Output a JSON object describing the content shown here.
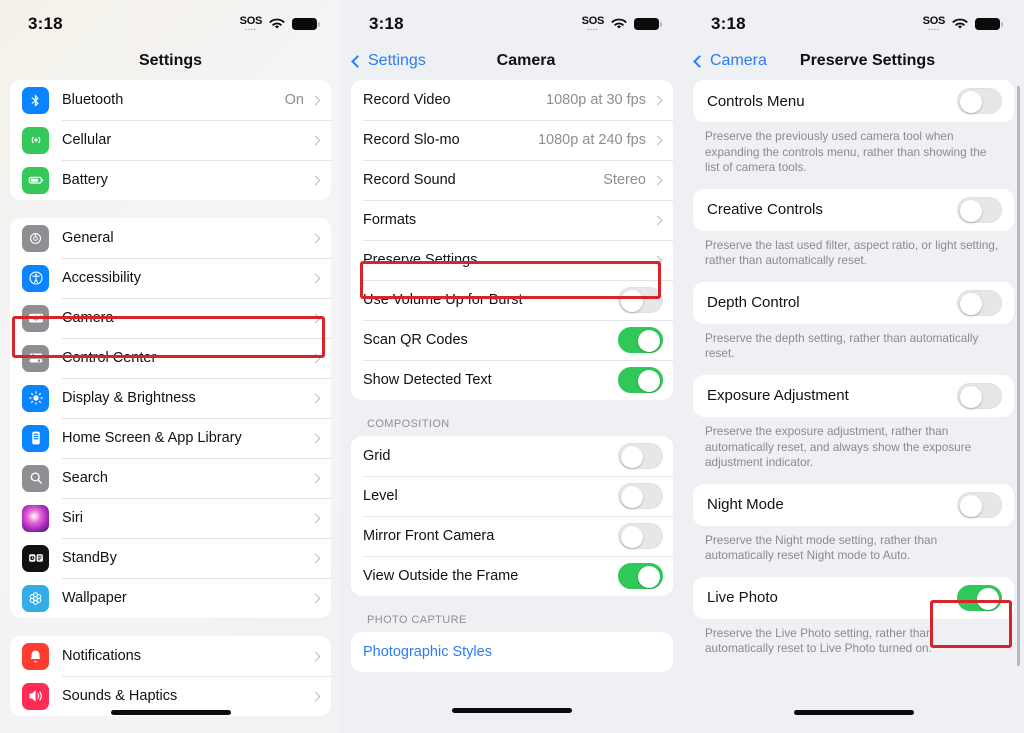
{
  "status": {
    "time": "3:18",
    "sos_label": "SOS",
    "wifi_icon": "wifi-icon",
    "battery_icon": "battery-icon"
  },
  "colors": {
    "accent_blue": "#2b7cf6",
    "toggle_on_green": "#31c85a",
    "annotation_red": "#d8232a",
    "page_bg": "#eff0f4",
    "card_bg": "#ffffff",
    "secondary_text": "#8e8e93"
  },
  "panels": {
    "left": {
      "nav_title": "Settings",
      "groups": [
        {
          "rows": [
            {
              "label": "Bluetooth",
              "value": "On",
              "icon": "bluetooth-icon",
              "icon_color": "#0a84ff",
              "type": "link"
            },
            {
              "label": "Cellular",
              "value": "",
              "icon": "cellular-icon",
              "icon_color": "#34c759",
              "type": "link"
            },
            {
              "label": "Battery",
              "value": "",
              "icon": "battery-app-icon",
              "icon_color": "#34c759",
              "type": "link"
            }
          ]
        },
        {
          "rows": [
            {
              "label": "General",
              "value": "",
              "icon": "gear-icon",
              "icon_color": "#8e8e93",
              "type": "link"
            },
            {
              "label": "Accessibility",
              "value": "",
              "icon": "accessibility-icon",
              "icon_color": "#0a84ff",
              "type": "link"
            },
            {
              "label": "Camera",
              "value": "",
              "icon": "camera-icon",
              "icon_color": "#8e8e93",
              "type": "link",
              "highlighted": true
            },
            {
              "label": "Control Center",
              "value": "",
              "icon": "control-center-icon",
              "icon_color": "#8e8e93",
              "type": "link"
            },
            {
              "label": "Display & Brightness",
              "value": "",
              "icon": "brightness-icon",
              "icon_color": "#0a84ff",
              "type": "link"
            },
            {
              "label": "Home Screen & App Library",
              "value": "",
              "icon": "home-screen-icon",
              "icon_color": "#0a84ff",
              "type": "link"
            },
            {
              "label": "Search",
              "value": "",
              "icon": "search-icon",
              "icon_color": "#8e8e93",
              "type": "link"
            },
            {
              "label": "Siri",
              "value": "",
              "icon": "siri-icon",
              "icon_color": "#5b2bd6",
              "type": "link"
            },
            {
              "label": "StandBy",
              "value": "",
              "icon": "standby-icon",
              "icon_color": "#111111",
              "type": "link"
            },
            {
              "label": "Wallpaper",
              "value": "",
              "icon": "wallpaper-icon",
              "icon_color": "#32ade6",
              "type": "link"
            }
          ]
        },
        {
          "rows": [
            {
              "label": "Notifications",
              "value": "",
              "icon": "notifications-icon",
              "icon_color": "#ff3b30",
              "type": "link"
            },
            {
              "label": "Sounds & Haptics",
              "value": "",
              "icon": "sounds-icon",
              "icon_color": "#ff2d55",
              "type": "link"
            }
          ]
        }
      ]
    },
    "middle": {
      "nav_back": "Settings",
      "nav_title": "Camera",
      "groups": [
        {
          "rows": [
            {
              "label": "Record Video",
              "value": "1080p at 30 fps",
              "type": "link"
            },
            {
              "label": "Record Slo-mo",
              "value": "1080p at 240 fps",
              "type": "link"
            },
            {
              "label": "Record Sound",
              "value": "Stereo",
              "type": "link"
            },
            {
              "label": "Formats",
              "value": "",
              "type": "link"
            },
            {
              "label": "Preserve Settings",
              "value": "",
              "type": "link",
              "highlighted": true
            },
            {
              "label": "Use Volume Up for Burst",
              "value": "",
              "type": "toggle",
              "on": false
            },
            {
              "label": "Scan QR Codes",
              "value": "",
              "type": "toggle",
              "on": true
            },
            {
              "label": "Show Detected Text",
              "value": "",
              "type": "toggle",
              "on": true
            }
          ]
        },
        {
          "header": "COMPOSITION",
          "rows": [
            {
              "label": "Grid",
              "value": "",
              "type": "toggle",
              "on": false
            },
            {
              "label": "Level",
              "value": "",
              "type": "toggle",
              "on": false
            },
            {
              "label": "Mirror Front Camera",
              "value": "",
              "type": "toggle",
              "on": false
            },
            {
              "label": "View Outside the Frame",
              "value": "",
              "type": "toggle",
              "on": true
            }
          ]
        },
        {
          "header": "PHOTO CAPTURE",
          "rows": [
            {
              "label": "Photographic Styles",
              "value": "",
              "type": "link",
              "blue": true
            }
          ]
        }
      ]
    },
    "right": {
      "nav_back": "Camera",
      "nav_title": "Preserve Settings",
      "items": [
        {
          "label": "Controls Menu",
          "on": false,
          "footnote": "Preserve the previously used camera tool when expanding the controls menu, rather than showing the list of camera tools."
        },
        {
          "label": "Creative Controls",
          "on": false,
          "footnote": "Preserve the last used filter, aspect ratio, or light setting, rather than automatically reset."
        },
        {
          "label": "Depth Control",
          "on": false,
          "footnote": "Preserve the depth setting, rather than automatically reset."
        },
        {
          "label": "Exposure Adjustment",
          "on": false,
          "footnote": "Preserve the exposure adjustment, rather than automatically reset, and always show the exposure adjustment indicator."
        },
        {
          "label": "Night Mode",
          "on": false,
          "footnote": "Preserve the Night mode setting, rather than automatically reset Night mode to Auto."
        },
        {
          "label": "Live Photo",
          "on": true,
          "highlighted": true,
          "footnote": "Preserve the Live Photo setting, rather than automatically reset to Live Photo turned on."
        }
      ]
    }
  }
}
